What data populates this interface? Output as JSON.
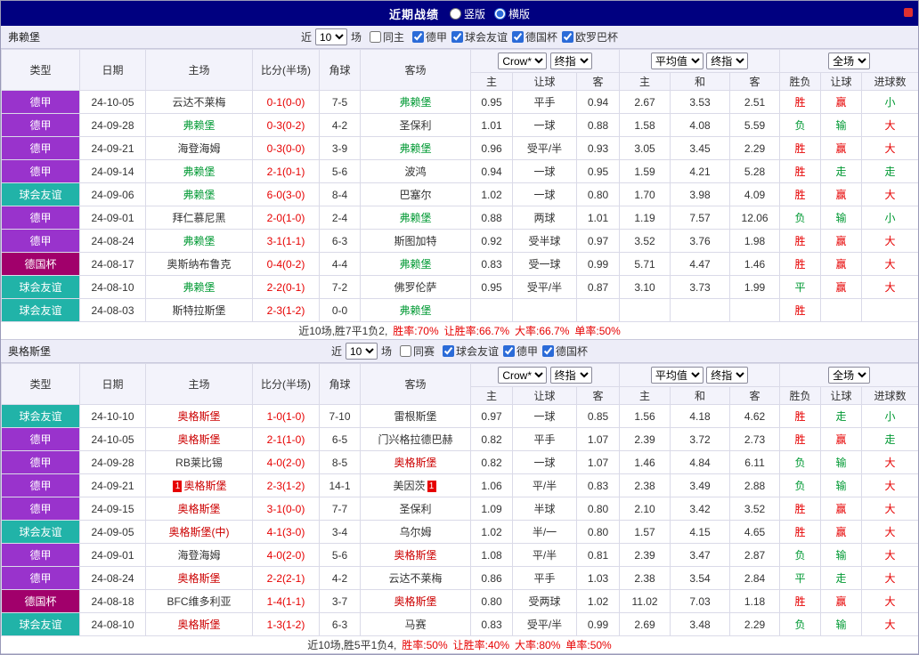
{
  "topbar": {
    "title": "近期战绩",
    "radios": [
      {
        "label": "竖版",
        "checked": false
      },
      {
        "label": "横版",
        "checked": true
      }
    ]
  },
  "colors": {
    "r": "#e60000",
    "g": "#009933",
    "k": "#333333",
    "score": "#e60000",
    "topbar_bg": "#000080",
    "header_bg": "#F3F3FB"
  },
  "type_colors": {
    "德甲": "#9933CC",
    "球会友谊": "#21B3A8",
    "德国杯": "#A1006B"
  },
  "sections": [
    {
      "team": "弗赖堡",
      "team_color": "#009933",
      "filters": {
        "near": "近",
        "count": "10",
        "games": "场",
        "same": {
          "label": "同主",
          "checked": false
        },
        "leagues": [
          "德甲",
          "球会友谊",
          "德国杯",
          "欧罗巴杯"
        ]
      },
      "header": {
        "cols": [
          "类型",
          "日期",
          "主场",
          "比分(半场)",
          "角球",
          "客场"
        ],
        "odds1_selects": [
          "Crow*",
          "终指"
        ],
        "odds1_cols": [
          "主",
          "让球",
          "客"
        ],
        "odds2_selects": [
          "平均值",
          "终指"
        ],
        "odds2_cols": [
          "主",
          "和",
          "客"
        ],
        "result_select": "全场",
        "result_cols": [
          "胜负",
          "让球",
          "进球数"
        ]
      },
      "rows": [
        {
          "type": "德甲",
          "date": "24-10-05",
          "home": {
            "name": "云达不莱梅"
          },
          "score": "0-1(0-0)",
          "corner": "7-5",
          "away": {
            "name": "弗赖堡",
            "focus": true
          },
          "odds1": [
            "0.95",
            "平手",
            "0.94"
          ],
          "odds2": [
            "2.67",
            "3.53",
            "2.51"
          ],
          "result": [
            [
              "胜",
              "r"
            ],
            [
              "赢",
              "r"
            ],
            [
              "小",
              "g"
            ]
          ]
        },
        {
          "type": "德甲",
          "date": "24-09-28",
          "home": {
            "name": "弗赖堡",
            "focus": true
          },
          "score": "0-3(0-2)",
          "corner": "4-2",
          "away": {
            "name": "圣保利"
          },
          "odds1": [
            "1.01",
            "一球",
            "0.88"
          ],
          "odds2": [
            "1.58",
            "4.08",
            "5.59"
          ],
          "result": [
            [
              "负",
              "g"
            ],
            [
              "输",
              "g"
            ],
            [
              "大",
              "r"
            ]
          ]
        },
        {
          "type": "德甲",
          "date": "24-09-21",
          "home": {
            "name": "海登海姆"
          },
          "score": "0-3(0-0)",
          "corner": "3-9",
          "away": {
            "name": "弗赖堡",
            "focus": true
          },
          "odds1": [
            "0.96",
            "受平/半",
            "0.93"
          ],
          "odds2": [
            "3.05",
            "3.45",
            "2.29"
          ],
          "result": [
            [
              "胜",
              "r"
            ],
            [
              "赢",
              "r"
            ],
            [
              "大",
              "r"
            ]
          ]
        },
        {
          "type": "德甲",
          "date": "24-09-14",
          "home": {
            "name": "弗赖堡",
            "focus": true
          },
          "score": "2-1(0-1)",
          "corner": "5-6",
          "away": {
            "name": "波鸿"
          },
          "odds1": [
            "0.94",
            "一球",
            "0.95"
          ],
          "odds2": [
            "1.59",
            "4.21",
            "5.28"
          ],
          "result": [
            [
              "胜",
              "r"
            ],
            [
              "走",
              "g"
            ],
            [
              "走",
              "g"
            ]
          ]
        },
        {
          "type": "球会友谊",
          "date": "24-09-06",
          "home": {
            "name": "弗赖堡",
            "focus": true
          },
          "score": "6-0(3-0)",
          "corner": "8-4",
          "away": {
            "name": "巴塞尔"
          },
          "odds1": [
            "1.02",
            "一球",
            "0.80"
          ],
          "odds2": [
            "1.70",
            "3.98",
            "4.09"
          ],
          "result": [
            [
              "胜",
              "r"
            ],
            [
              "赢",
              "r"
            ],
            [
              "大",
              "r"
            ]
          ]
        },
        {
          "type": "德甲",
          "date": "24-09-01",
          "home": {
            "name": "拜仁慕尼黑"
          },
          "score": "2-0(1-0)",
          "corner": "2-4",
          "away": {
            "name": "弗赖堡",
            "focus": true
          },
          "odds1": [
            "0.88",
            "两球",
            "1.01"
          ],
          "odds2": [
            "1.19",
            "7.57",
            "12.06"
          ],
          "result": [
            [
              "负",
              "g"
            ],
            [
              "输",
              "g"
            ],
            [
              "小",
              "g"
            ]
          ]
        },
        {
          "type": "德甲",
          "date": "24-08-24",
          "home": {
            "name": "弗赖堡",
            "focus": true
          },
          "score": "3-1(1-1)",
          "corner": "6-3",
          "away": {
            "name": "斯图加特"
          },
          "odds1": [
            "0.92",
            "受半球",
            "0.97"
          ],
          "odds2": [
            "3.52",
            "3.76",
            "1.98"
          ],
          "result": [
            [
              "胜",
              "r"
            ],
            [
              "赢",
              "r"
            ],
            [
              "大",
              "r"
            ]
          ]
        },
        {
          "type": "德国杯",
          "date": "24-08-17",
          "home": {
            "name": "奥斯纳布鲁克"
          },
          "score": "0-4(0-2)",
          "corner": "4-4",
          "away": {
            "name": "弗赖堡",
            "focus": true
          },
          "odds1": [
            "0.83",
            "受一球",
            "0.99"
          ],
          "odds2": [
            "5.71",
            "4.47",
            "1.46"
          ],
          "result": [
            [
              "胜",
              "r"
            ],
            [
              "赢",
              "r"
            ],
            [
              "大",
              "r"
            ]
          ]
        },
        {
          "type": "球会友谊",
          "date": "24-08-10",
          "home": {
            "name": "弗赖堡",
            "focus": true
          },
          "score": "2-2(0-1)",
          "corner": "7-2",
          "away": {
            "name": "佛罗伦萨"
          },
          "odds1": [
            "0.95",
            "受平/半",
            "0.87"
          ],
          "odds2": [
            "3.10",
            "3.73",
            "1.99"
          ],
          "result": [
            [
              "平",
              "g"
            ],
            [
              "赢",
              "r"
            ],
            [
              "大",
              "r"
            ]
          ]
        },
        {
          "type": "球会友谊",
          "date": "24-08-03",
          "home": {
            "name": "斯特拉斯堡"
          },
          "score": "2-3(1-2)",
          "corner": "0-0",
          "away": {
            "name": "弗赖堡",
            "focus": true
          },
          "odds1": [
            "",
            "",
            ""
          ],
          "odds2": [
            "",
            "",
            ""
          ],
          "result": [
            [
              "胜",
              "r"
            ],
            [
              "",
              ""
            ],
            [
              "",
              ""
            ]
          ]
        }
      ],
      "summary": [
        [
          "近10场,胜7平1负2,",
          "k"
        ],
        [
          "胜率:70%",
          "r"
        ],
        [
          "让胜率:66.7%",
          "r"
        ],
        [
          "大率:66.7%",
          "r"
        ],
        [
          "单率:50%",
          "r"
        ]
      ]
    },
    {
      "team": "奥格斯堡",
      "team_color": "#cc0000",
      "filters": {
        "near": "近",
        "count": "10",
        "games": "场",
        "same": {
          "label": "同赛",
          "checked": false
        },
        "leagues": [
          "球会友谊",
          "德甲",
          "德国杯"
        ]
      },
      "header": {
        "cols": [
          "类型",
          "日期",
          "主场",
          "比分(半场)",
          "角球",
          "客场"
        ],
        "odds1_selects": [
          "Crow*",
          "终指"
        ],
        "odds1_cols": [
          "主",
          "让球",
          "客"
        ],
        "odds2_selects": [
          "平均值",
          "终指"
        ],
        "odds2_cols": [
          "主",
          "和",
          "客"
        ],
        "result_select": "全场",
        "result_cols": [
          "胜负",
          "让球",
          "进球数"
        ]
      },
      "rows": [
        {
          "type": "球会友谊",
          "date": "24-10-10",
          "home": {
            "name": "奥格斯堡",
            "focus": true
          },
          "score": "1-0(1-0)",
          "corner": "7-10",
          "away": {
            "name": "雷根斯堡"
          },
          "odds1": [
            "0.97",
            "一球",
            "0.85"
          ],
          "odds2": [
            "1.56",
            "4.18",
            "4.62"
          ],
          "result": [
            [
              "胜",
              "r"
            ],
            [
              "走",
              "g"
            ],
            [
              "小",
              "g"
            ]
          ]
        },
        {
          "type": "德甲",
          "date": "24-10-05",
          "home": {
            "name": "奥格斯堡",
            "focus": true
          },
          "score": "2-1(1-0)",
          "corner": "6-5",
          "away": {
            "name": "门兴格拉德巴赫"
          },
          "odds1": [
            "0.82",
            "平手",
            "1.07"
          ],
          "odds2": [
            "2.39",
            "3.72",
            "2.73"
          ],
          "result": [
            [
              "胜",
              "r"
            ],
            [
              "赢",
              "r"
            ],
            [
              "走",
              "g"
            ]
          ]
        },
        {
          "type": "德甲",
          "date": "24-09-28",
          "home": {
            "name": "RB莱比锡"
          },
          "score": "4-0(2-0)",
          "corner": "8-5",
          "away": {
            "name": "奥格斯堡",
            "focus": true
          },
          "odds1": [
            "0.82",
            "一球",
            "1.07"
          ],
          "odds2": [
            "1.46",
            "4.84",
            "6.11"
          ],
          "result": [
            [
              "负",
              "g"
            ],
            [
              "输",
              "g"
            ],
            [
              "大",
              "r"
            ]
          ]
        },
        {
          "type": "德甲",
          "date": "24-09-21",
          "home": {
            "name": "奥格斯堡",
            "focus": true,
            "card_before": "1"
          },
          "score": "2-3(1-2)",
          "corner": "14-1",
          "away": {
            "name": "美因茨",
            "card_after": "1"
          },
          "odds1": [
            "1.06",
            "平/半",
            "0.83"
          ],
          "odds2": [
            "2.38",
            "3.49",
            "2.88"
          ],
          "result": [
            [
              "负",
              "g"
            ],
            [
              "输",
              "g"
            ],
            [
              "大",
              "r"
            ]
          ]
        },
        {
          "type": "德甲",
          "date": "24-09-15",
          "home": {
            "name": "奥格斯堡",
            "focus": true
          },
          "score": "3-1(0-0)",
          "corner": "7-7",
          "away": {
            "name": "圣保利"
          },
          "odds1": [
            "1.09",
            "半球",
            "0.80"
          ],
          "odds2": [
            "2.10",
            "3.42",
            "3.52"
          ],
          "result": [
            [
              "胜",
              "r"
            ],
            [
              "赢",
              "r"
            ],
            [
              "大",
              "r"
            ]
          ]
        },
        {
          "type": "球会友谊",
          "date": "24-09-05",
          "home": {
            "name": "奥格斯堡(中)",
            "focus": true
          },
          "score": "4-1(3-0)",
          "corner": "3-4",
          "away": {
            "name": "乌尔姆"
          },
          "odds1": [
            "1.02",
            "半/一",
            "0.80"
          ],
          "odds2": [
            "1.57",
            "4.15",
            "4.65"
          ],
          "result": [
            [
              "胜",
              "r"
            ],
            [
              "赢",
              "r"
            ],
            [
              "大",
              "r"
            ]
          ]
        },
        {
          "type": "德甲",
          "date": "24-09-01",
          "home": {
            "name": "海登海姆"
          },
          "score": "4-0(2-0)",
          "corner": "5-6",
          "away": {
            "name": "奥格斯堡",
            "focus": true
          },
          "odds1": [
            "1.08",
            "平/半",
            "0.81"
          ],
          "odds2": [
            "2.39",
            "3.47",
            "2.87"
          ],
          "result": [
            [
              "负",
              "g"
            ],
            [
              "输",
              "g"
            ],
            [
              "大",
              "r"
            ]
          ]
        },
        {
          "type": "德甲",
          "date": "24-08-24",
          "home": {
            "name": "奥格斯堡",
            "focus": true
          },
          "score": "2-2(2-1)",
          "corner": "4-2",
          "away": {
            "name": "云达不莱梅"
          },
          "odds1": [
            "0.86",
            "平手",
            "1.03"
          ],
          "odds2": [
            "2.38",
            "3.54",
            "2.84"
          ],
          "result": [
            [
              "平",
              "g"
            ],
            [
              "走",
              "g"
            ],
            [
              "大",
              "r"
            ]
          ]
        },
        {
          "type": "德国杯",
          "date": "24-08-18",
          "home": {
            "name": "BFC维多利亚"
          },
          "score": "1-4(1-1)",
          "corner": "3-7",
          "away": {
            "name": "奥格斯堡",
            "focus": true
          },
          "odds1": [
            "0.80",
            "受两球",
            "1.02"
          ],
          "odds2": [
            "11.02",
            "7.03",
            "1.18"
          ],
          "result": [
            [
              "胜",
              "r"
            ],
            [
              "赢",
              "r"
            ],
            [
              "大",
              "r"
            ]
          ]
        },
        {
          "type": "球会友谊",
          "date": "24-08-10",
          "home": {
            "name": "奥格斯堡",
            "focus": true
          },
          "score": "1-3(1-2)",
          "corner": "6-3",
          "away": {
            "name": "马赛"
          },
          "odds1": [
            "0.83",
            "受平/半",
            "0.99"
          ],
          "odds2": [
            "2.69",
            "3.48",
            "2.29"
          ],
          "result": [
            [
              "负",
              "g"
            ],
            [
              "输",
              "g"
            ],
            [
              "大",
              "r"
            ]
          ]
        }
      ],
      "summary": [
        [
          "近10场,胜5平1负4,",
          "k"
        ],
        [
          "胜率:50%",
          "r"
        ],
        [
          "让胜率:40%",
          "r"
        ],
        [
          "大率:80%",
          "r"
        ],
        [
          "单率:50%",
          "r"
        ]
      ]
    }
  ]
}
